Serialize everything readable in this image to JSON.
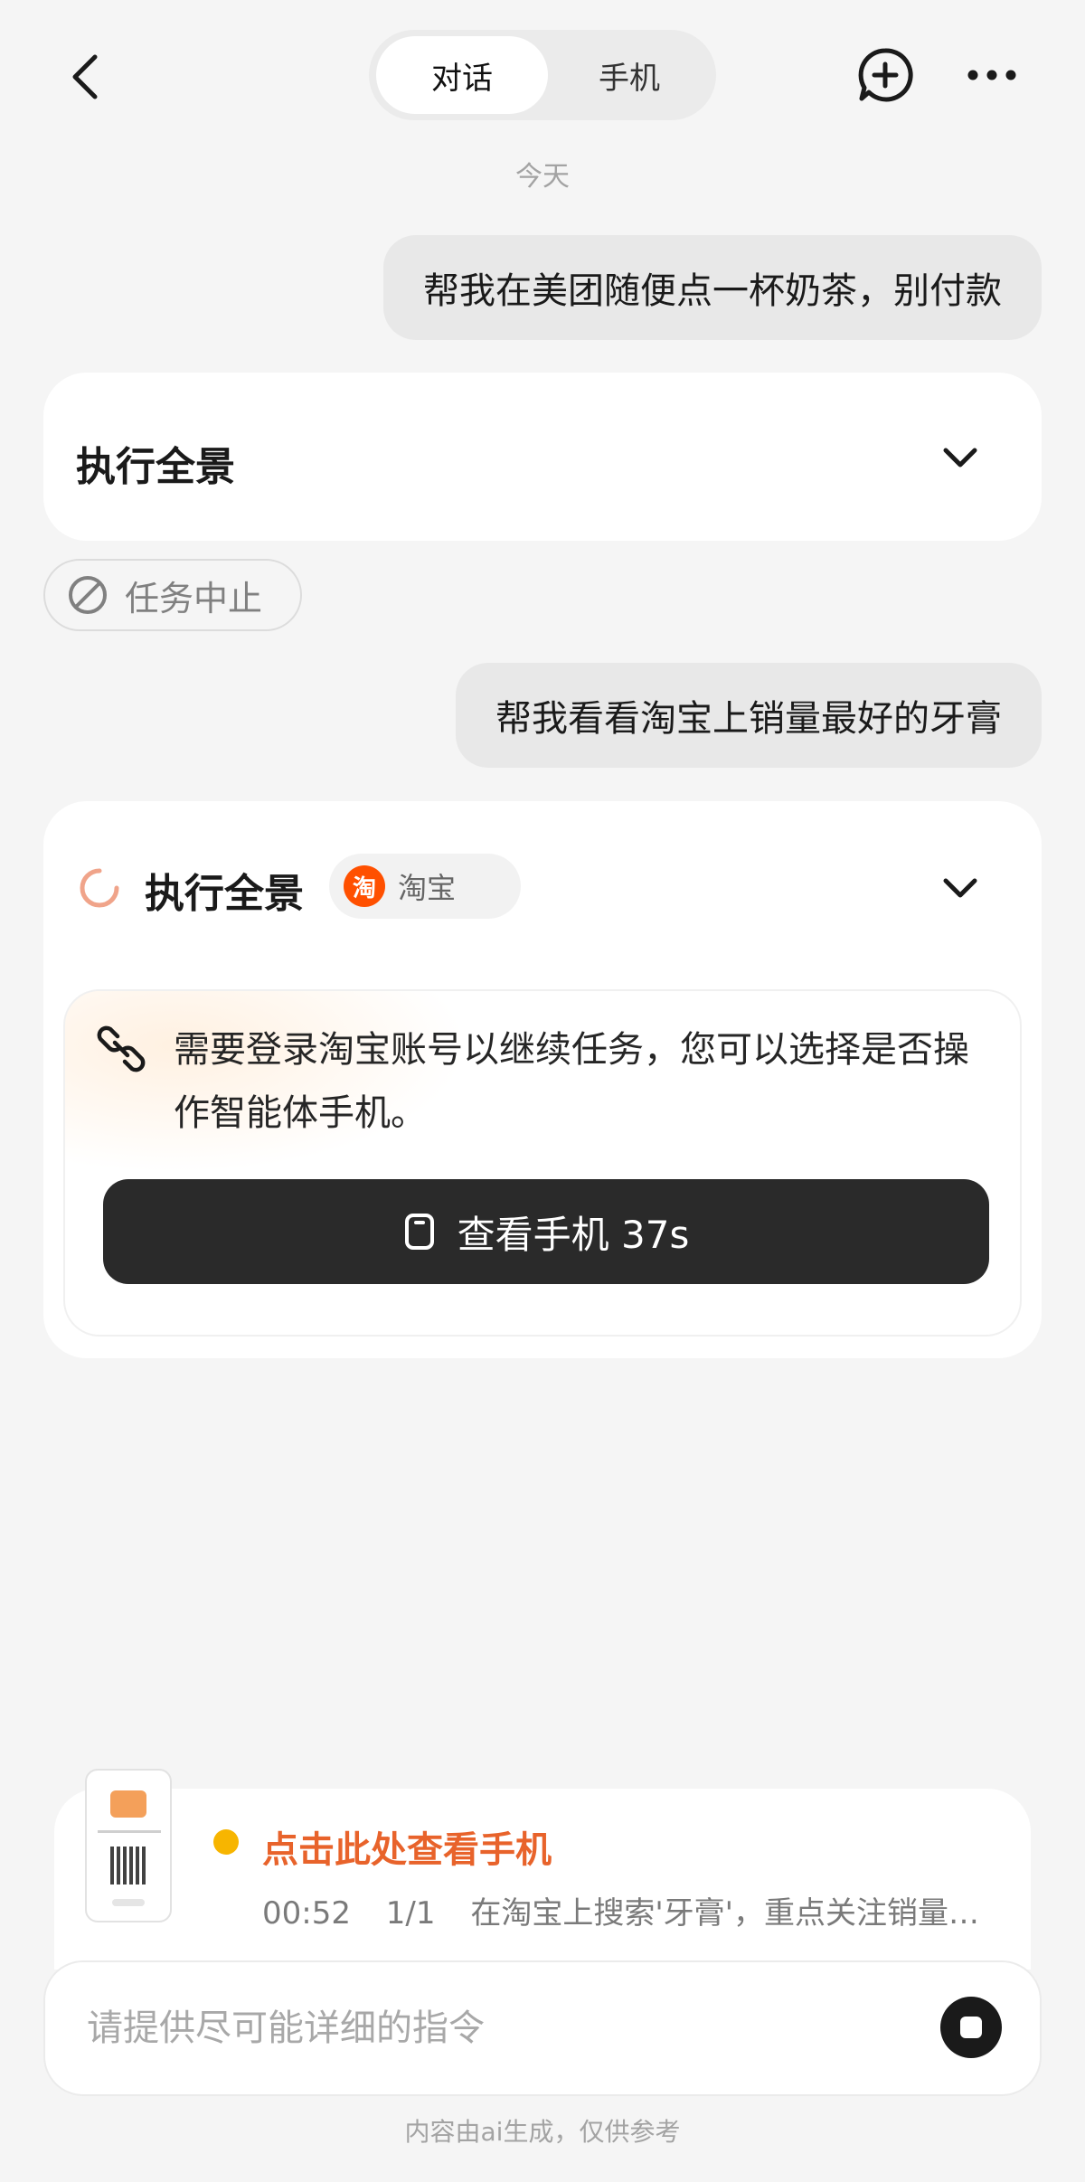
{
  "header": {
    "tabs": [
      {
        "label": "对话",
        "active": true
      },
      {
        "label": "手机",
        "active": false
      }
    ],
    "icons": {
      "back": "chevron-left-icon",
      "new_chat": "chat-plus-icon",
      "more": "ellipsis-icon"
    }
  },
  "date_label": "今天",
  "messages": [
    {
      "role": "user",
      "text": "帮我在美团随便点一杯奶茶，别付款"
    },
    {
      "role": "user",
      "text": "帮我看看淘宝上销量最好的牙膏"
    }
  ],
  "task_cards": [
    {
      "title": "执行全景",
      "status_pill": {
        "label": "任务中止",
        "icon": "prohibited-icon"
      }
    },
    {
      "title": "执行全景",
      "app_tag": {
        "logo_text": "淘",
        "label": "淘宝"
      },
      "login_prompt": {
        "text": "需要登录淘宝账号以继续任务，您可以选择是否操作智能体手机。",
        "button_label": "查看手机 37s"
      }
    }
  ],
  "task_strip": {
    "title": "点击此处查看手机",
    "elapsed": "00:52",
    "progress": "1/1",
    "step_text": "在淘宝上搜索'牙膏'，重点关注销量…"
  },
  "input": {
    "placeholder": "请提供尽可能详细的指令",
    "value": ""
  },
  "disclaimer": "内容由ai生成，仅供参考",
  "colors": {
    "background": "#f5f5f5",
    "accent_orange": "#e8632b",
    "status_dot": "#f7b500",
    "taobao_orange": "#ff5000",
    "button_dark": "#2a2a2a"
  }
}
